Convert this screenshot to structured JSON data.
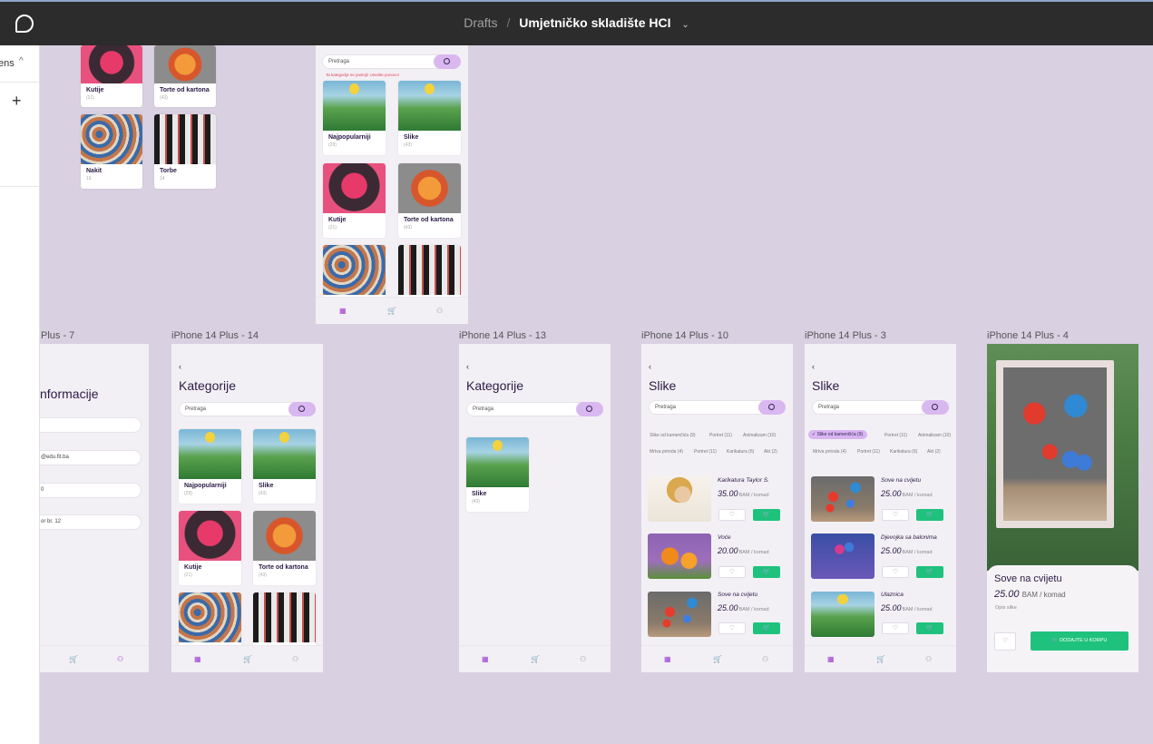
{
  "topbar": {
    "drafts": "Drafts",
    "separator": "/",
    "title": "Umjetničko skladište HCI",
    "chevron": "⌄"
  },
  "leftpanel": {
    "label": "ens",
    "chevron": "^",
    "plus": "+"
  },
  "frames": {
    "f7": "Plus - 7",
    "f14": "iPhone 14 Plus - 14",
    "f13": "iPhone 14 Plus - 13",
    "f10": "iPhone 14 Plus - 10",
    "f3": "iPhone 14 Plus - 3",
    "f4": "iPhone 14 Plus - 4"
  },
  "categories": [
    {
      "name": "Najpopularniji",
      "count": "(29)"
    },
    {
      "name": "Slike",
      "count": "(43)"
    },
    {
      "name": "Kutije",
      "count": "(21)"
    },
    {
      "name": "Torte od kartona",
      "count": "(43)"
    },
    {
      "name": "Nakit",
      "count": "19"
    },
    {
      "name": "Torbe",
      "count": "14"
    }
  ],
  "search": {
    "placeholder": "Pretraga",
    "error": "Ta kategorija ne postoji! Unesite ponovo!"
  },
  "kategorije": {
    "title": "Kategorije",
    "back": "‹"
  },
  "informacije": {
    "title": "nformacije",
    "email": "@edu.fit.ba",
    "phone": "0",
    "address": "or br. 12"
  },
  "slike": {
    "title": "Slike",
    "chips": [
      "Slike od kamenčića (9)",
      "Portret (11)",
      "Animalizam (10)",
      "Mrtva priroda (4)",
      "Portret (11)",
      "Karikatura (6)",
      "Akt (2)"
    ],
    "chips_active": "✓ Slike od kamenčića (9)"
  },
  "products10": [
    {
      "name": "Karikatura Taylor S.",
      "price": "35.00",
      "unit": "BAM / komad"
    },
    {
      "name": "Voće",
      "price": "20.00",
      "unit": "BAM / komad"
    },
    {
      "name": "Sove na cvijetu",
      "price": "25.00",
      "unit": "BAM / komad"
    }
  ],
  "products3": [
    {
      "name": "Sove na cvijetu",
      "price": "25.00",
      "unit": "BAM / komad"
    },
    {
      "name": "Djevojka sa balonima",
      "price": "25.00",
      "unit": "BAM / komad"
    },
    {
      "name": "Ulaznica",
      "price": "25.00",
      "unit": "BAM / komad"
    }
  ],
  "detail": {
    "name": "Sove na cvijetu",
    "price": "25.00",
    "unit": "BAM / komad",
    "desc": "Opis slike",
    "add": "DODAJTE U KORPU"
  },
  "icons": {
    "heart": "♡",
    "cart": "🛒",
    "grid": "▦",
    "user": "⚇"
  }
}
